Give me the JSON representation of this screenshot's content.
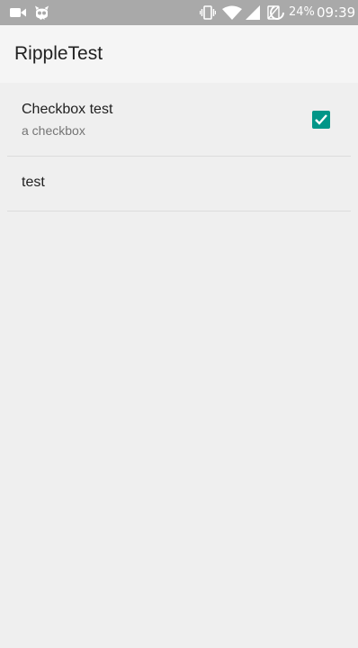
{
  "status_bar": {
    "left_icons": [
      "video-camera-icon",
      "cyanogen-mascot-icon"
    ],
    "right_icons": [
      "vibrate-icon",
      "wifi-icon",
      "cellular-signal-icon",
      "no-sim-icon",
      "battery-charging-icon"
    ],
    "battery_percent": "24%",
    "time": "09:39"
  },
  "app_bar": {
    "title": "RippleTest"
  },
  "preferences": [
    {
      "title": "Checkbox test",
      "summary": "a checkbox",
      "checked": true
    },
    {
      "title": "test"
    }
  ],
  "colors": {
    "accent": "#009688",
    "status_bar": "#a9a9a9",
    "app_bar": "#f5f5f5",
    "background": "#efefef"
  }
}
